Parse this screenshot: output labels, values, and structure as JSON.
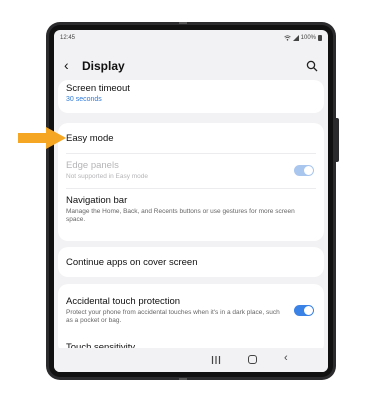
{
  "status_bar": {
    "time": "12:45",
    "battery": "100%"
  },
  "header": {
    "title": "Display",
    "back_icon": "chevron-left-icon",
    "search_icon": "search-icon"
  },
  "items": {
    "screen_timeout": {
      "title": "Screen timeout",
      "value": "30 seconds"
    },
    "easy_mode": {
      "title": "Easy mode"
    },
    "edge_panels": {
      "title": "Edge panels",
      "subtitle": "Not supported in Easy mode",
      "enabled": true
    },
    "navigation_bar": {
      "title": "Navigation bar",
      "subtitle": "Manage the Home, Back, and Recents buttons or use gestures for more screen space."
    },
    "continue_apps": {
      "title": "Continue apps on cover screen"
    },
    "accidental_touch": {
      "title": "Accidental touch protection",
      "subtitle": "Protect your phone from accidental touches when it's in a dark place, such as a pocket or bag.",
      "enabled": true
    },
    "touch_sensitivity": {
      "title": "Touch sensitivity"
    }
  },
  "colors": {
    "accent": "#3b82e6",
    "pointer": "#f5a623",
    "background": "#f2f2f4"
  }
}
